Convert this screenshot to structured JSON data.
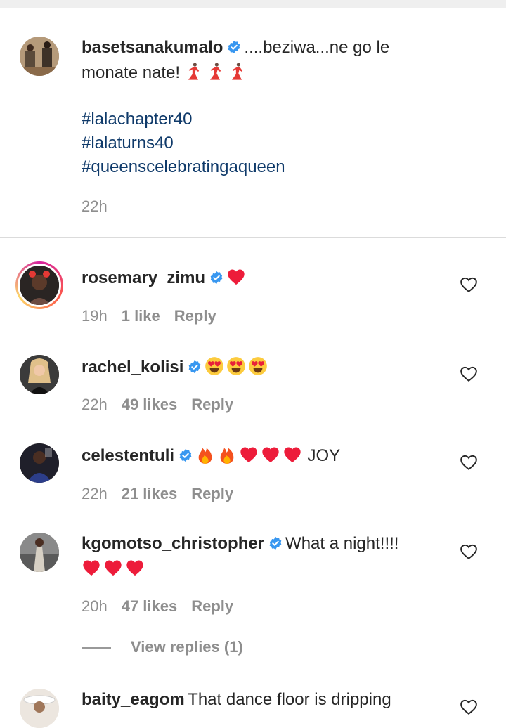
{
  "caption": {
    "username": "basetsanakumalo",
    "text_line1": "....beziwa...ne go le",
    "text_line2": "monate nate!",
    "hashtags": [
      "#lalachapter40",
      "#lalaturns40",
      "#queenscelebratingaqueen"
    ],
    "time": "22h"
  },
  "comments": [
    {
      "username": "rosemary_zimu",
      "text": "",
      "time": "19h",
      "likes": "1 like",
      "reply": "Reply"
    },
    {
      "username": "rachel_kolisi",
      "text": "",
      "time": "22h",
      "likes": "49 likes",
      "reply": "Reply"
    },
    {
      "username": "celestentuli",
      "text": "JOY",
      "time": "22h",
      "likes": "21 likes",
      "reply": "Reply"
    },
    {
      "username": "kgomotso_christopher",
      "text": "What a night!!!!",
      "time": "20h",
      "likes": "47 likes",
      "reply": "Reply"
    },
    {
      "username": "baity_eagom",
      "text": "That dance floor is dripping",
      "time": "",
      "likes": "",
      "reply": ""
    }
  ],
  "view_replies": "View replies (1)",
  "colors": {
    "verified": "#3897f0",
    "heart": "#ed1c3a",
    "hashtag": "#0f3a6a",
    "meta": "#8e8e8e"
  },
  "icons": [
    "verified-badge-icon",
    "dancer-emoji-icon",
    "red-heart-emoji-icon",
    "heart-eyes-emoji-icon",
    "fire-emoji-icon",
    "like-heart-icon"
  ]
}
